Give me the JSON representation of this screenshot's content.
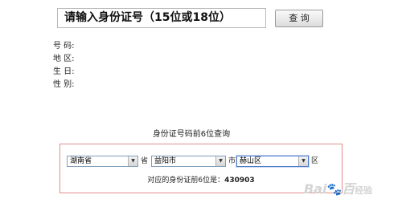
{
  "search": {
    "value": "请输入身份证号（15位或18位）"
  },
  "query_button": {
    "label": "查 询"
  },
  "result": {
    "number_label": "号 码:",
    "region_label": "地 区:",
    "birthday_label": "生 日:",
    "gender_label": "性 别:"
  },
  "lookup": {
    "title": "身份证号码前6位查询",
    "province": {
      "selected": "湖南省",
      "unit": "省"
    },
    "city": {
      "selected": "益阳市",
      "unit": "市"
    },
    "district": {
      "selected": "赫山区",
      "unit": "区"
    },
    "code_label": "对应的身份证前6位是：",
    "code_value": "430903"
  },
  "watermark": {
    "text": "Bai",
    "paw": "🐾",
    "after": "百",
    "sub": "经验"
  },
  "colors": {
    "panel_border": "#e08f88",
    "select_border": "#7f9db9"
  }
}
